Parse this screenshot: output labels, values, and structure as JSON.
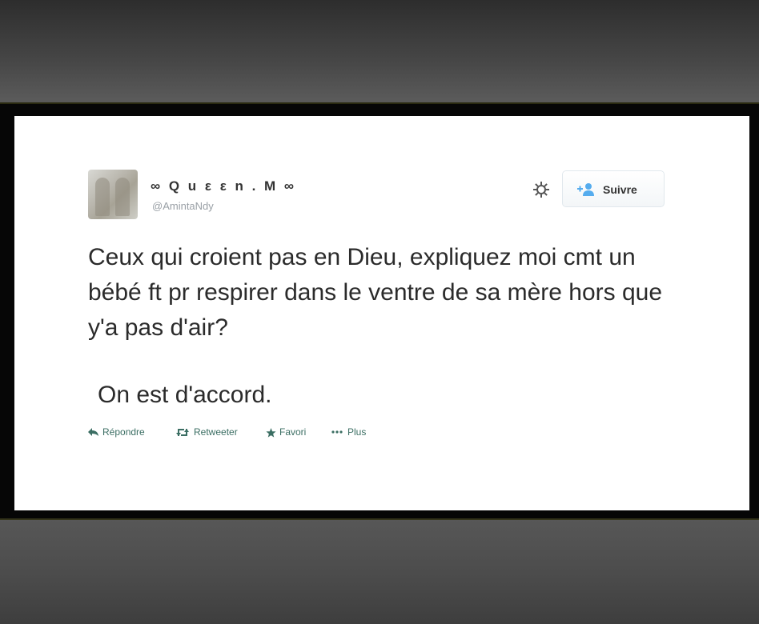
{
  "tweet": {
    "display_name": "∞ Q u ε ε n . M ∞",
    "handle": "@AmintaNdy",
    "follow_label": "Suivre",
    "text": "Ceux qui croient pas en Dieu, expliquez moi cmt un bébé ft pr respirer dans le ventre de sa mère hors que y'a pas d'air?",
    "caption": "On est d'accord.",
    "actions": {
      "reply": "Répondre",
      "retweet": "Retweeter",
      "favorite": "Favori",
      "more": "Plus"
    }
  },
  "icons": {
    "settings": "gear-icon",
    "follow": "add-person-icon",
    "reply": "reply-arrow-icon",
    "retweet": "retweet-icon",
    "favorite": "star-icon",
    "more": "ellipsis-icon"
  },
  "colors": {
    "action_text": "#3b6e63",
    "follow_icon": "#55acee",
    "card_background": "#ffffff",
    "frame": "#060606"
  }
}
